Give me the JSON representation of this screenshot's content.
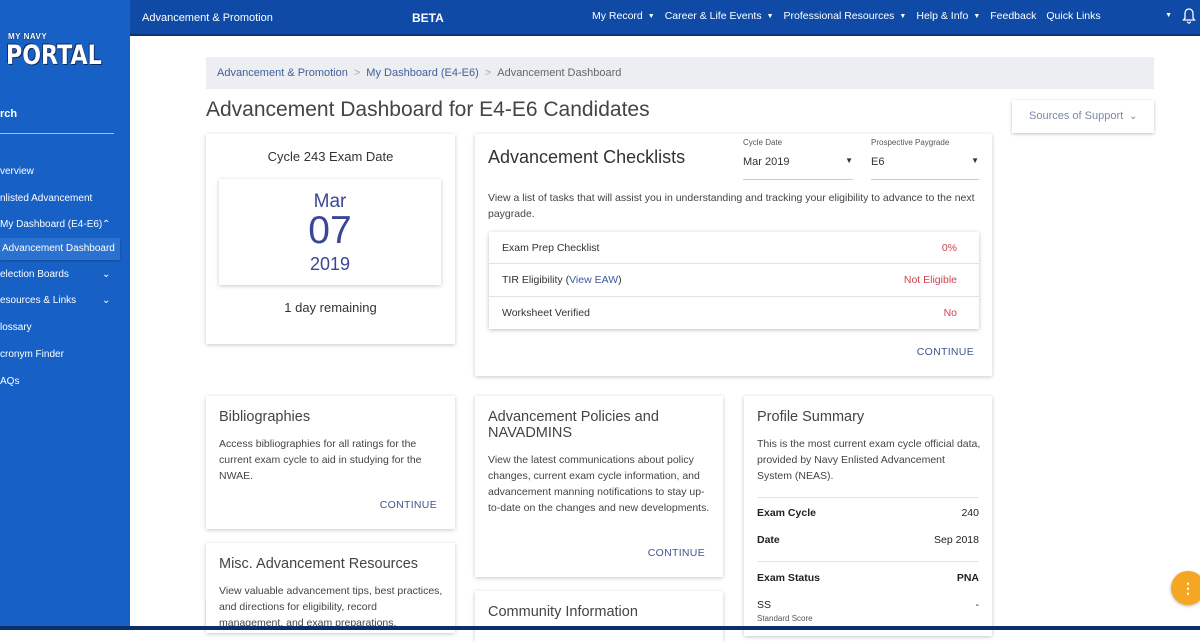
{
  "sidebar": {
    "logo_my": "MY NAVY",
    "logo_portal": "PORTAL",
    "search_label": "rch",
    "items": [
      {
        "label": "verview",
        "chevron": ""
      },
      {
        "label": "nlisted Advancement",
        "chevron": ""
      },
      {
        "label": "My Dashboard (E4-E6)",
        "chevron": "^"
      },
      {
        "label": "Advancement Dashboard",
        "chevron": "",
        "active": true
      },
      {
        "label": "election Boards",
        "chevron": "v"
      },
      {
        "label": "esources & Links",
        "chevron": "v"
      },
      {
        "label": "lossary",
        "chevron": ""
      },
      {
        "label": "cronym Finder",
        "chevron": ""
      },
      {
        "label": "AQs",
        "chevron": ""
      }
    ]
  },
  "topbar": {
    "section": "Advancement & Promotion",
    "beta": "BETA",
    "nav": [
      {
        "label": "My Record",
        "dropdown": "▼"
      },
      {
        "label": "Career & Life Events",
        "dropdown": "▼"
      },
      {
        "label": "Professional Resources",
        "dropdown": "▼"
      },
      {
        "label": "Help & Info",
        "dropdown": "▼"
      },
      {
        "label": "Feedback",
        "dropdown": ""
      },
      {
        "label": "Quick Links",
        "dropdown": ""
      }
    ],
    "user_caret": "▼",
    "bell_icon": "🔔"
  },
  "breadcrumb": {
    "items": [
      "Advancement & Promotion",
      "My Dashboard (E4-E6)"
    ],
    "separator": ">",
    "current": "Advancement Dashboard"
  },
  "page_title": "Advancement Dashboard for E4-E6 Candidates",
  "sources_of_support": {
    "label": "Sources of Support",
    "chevron": "⌄"
  },
  "exam_date": {
    "title": "Cycle 243 Exam Date",
    "month": "Mar",
    "day": "07",
    "year": "2019",
    "remaining": "1 day remaining"
  },
  "checklists": {
    "title": "Advancement Checklists",
    "cycle_date": {
      "label": "Cycle Date",
      "value": "Mar 2019"
    },
    "paygrade": {
      "label": "Prospective Paygrade",
      "value": "E6"
    },
    "description": "View a list of tasks that will assist you in understanding and tracking your eligibility to advance to the next paygrade.",
    "rows": [
      {
        "label": "Exam Prep Checklist",
        "link": "",
        "value": "0%"
      },
      {
        "label": "TIR Eligibility (",
        "link": "View EAW",
        "suffix": ")",
        "value": "Not Eligible"
      },
      {
        "label": "Worksheet Verified",
        "link": "",
        "value": "No"
      }
    ],
    "continue": "CONTINUE",
    "status_color": "#d0434f"
  },
  "bibliographies": {
    "title": "Bibliographies",
    "description": "Access bibliographies for all ratings for the current exam cycle to aid in studying for the NWAE.",
    "continue": "CONTINUE"
  },
  "misc": {
    "title": "Misc. Advancement Resources",
    "description": "View valuable advancement tips, best practices, and directions for eligibility, record management, and exam preparations."
  },
  "policies": {
    "title": "Advancement Policies and NAVADMINS",
    "description": "View the latest communications about policy changes, current exam cycle information, and advancement manning notifications to stay up-to-date on the changes and new developments.",
    "continue": "CONTINUE"
  },
  "community": {
    "title": "Community Information"
  },
  "profile": {
    "title": "Profile Summary",
    "description": "This is the most current exam cycle official data, provided by Navy Enlisted Advancement System (NEAS).",
    "exam_cycle": {
      "label": "Exam Cycle",
      "value": "240"
    },
    "date": {
      "label": "Date",
      "value": "Sep 2018"
    },
    "exam_status": {
      "label": "Exam Status",
      "value": "PNA"
    },
    "ss": {
      "label": "SS",
      "sublabel": "Standard Score",
      "value": "-"
    }
  },
  "fab_icon": "⋮",
  "colors": {
    "sidebar": "#1660c6",
    "topbar": "#0f4aa6",
    "accent": "#3b4796",
    "fab": "#f5a623"
  }
}
